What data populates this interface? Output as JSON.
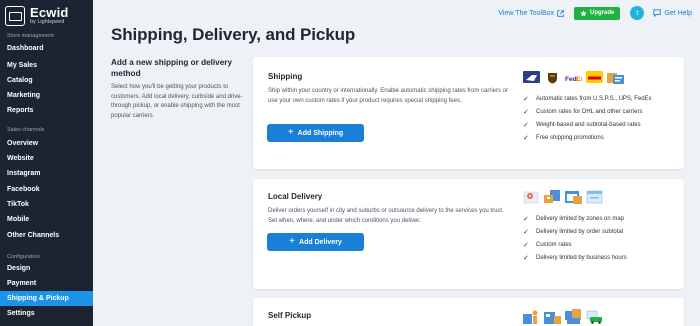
{
  "app": {
    "brand_name": "Ecwid",
    "brand_sub": "by Lightspeed"
  },
  "sidebar": {
    "sections": [
      {
        "title": "Store management",
        "items": [
          {
            "label": "Dashboard"
          },
          {
            "label": "My Sales"
          },
          {
            "label": "Catalog"
          },
          {
            "label": "Marketing"
          },
          {
            "label": "Reports"
          }
        ]
      },
      {
        "title": "Sales channels",
        "items": [
          {
            "label": "Overview"
          },
          {
            "label": "Website"
          },
          {
            "label": "Instagram"
          },
          {
            "label": "Facebook"
          },
          {
            "label": "TikTok"
          },
          {
            "label": "Mobile"
          },
          {
            "label": "Other Channels"
          }
        ]
      },
      {
        "title": "Configuration",
        "items": [
          {
            "label": "Design"
          },
          {
            "label": "Payment"
          },
          {
            "label": "Shipping & Pickup",
            "active": true
          },
          {
            "label": "Settings"
          }
        ]
      }
    ],
    "active_color": "#1a94e6"
  },
  "topbar": {
    "toolbox_label": "View The ToolBox",
    "upgrade_label": "Upgrade",
    "avatar_initial": "t",
    "help_label": "Get Help"
  },
  "page": {
    "title": "Shipping, Delivery, and Pickup",
    "intro_title": "Add a new shipping or delivery method",
    "intro_desc": "Select how you'll be getting your products to customers. Add local delivery, curbside and drive-through pickup, or enable shipping with the most popular carriers."
  },
  "cards": {
    "shipping": {
      "title": "Shipping",
      "desc": "Ship within your country or internationally. Enable automatic shipping rates from carriers or use your own custom rates if your product requires special shipping fees.",
      "button": "Add Shipping",
      "logos": [
        "usps-logo-icon",
        "ups-logo-icon",
        "fedex-logo-icon",
        "dhl-logo-icon",
        "custom-rates-icon"
      ],
      "features": [
        "Automatic rates from U.S.P.S., UPS, FedEx",
        "Custom rates for DHL and other carriers",
        "Weight-based and subtotal-based rates",
        "Free shipping promotions"
      ]
    },
    "local_delivery": {
      "title": "Local Delivery",
      "desc": "Deliver orders yourself in city and suburbs or outsource delivery to the services you trust. Set when, where, and under which conditions you deliver.",
      "button": "Add Delivery",
      "logos": [
        "map-pin-icon",
        "delivery-boxes-icon",
        "delivery-calendar-icon",
        "delivery-window-icon"
      ],
      "features": [
        "Delivery limited by zones on map",
        "Delivery limited by order subtotal",
        "Custom rates",
        "Delivery limited by business hours"
      ]
    },
    "self_pickup": {
      "title": "Self Pickup",
      "logos": [
        "pickup-person-icon",
        "pickup-store-icon",
        "pickup-boxes-icon",
        "pickup-car-icon"
      ]
    }
  },
  "colors": {
    "primary": "#1a7fd6",
    "upgrade": "#1fb142",
    "sidebar_bg": "#1c2431",
    "page_bg": "#eef1f5"
  }
}
